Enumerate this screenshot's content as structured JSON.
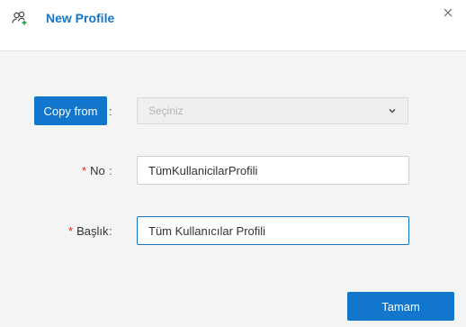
{
  "dialog": {
    "title": "New Profile",
    "header_icon": "add-users-icon",
    "close_icon": "close-icon"
  },
  "copy_from": {
    "button_label": "Copy from",
    "separator": ":",
    "select": {
      "value": "Seçiniz",
      "disabled": true,
      "icon": "chevron-down-icon"
    }
  },
  "no_field": {
    "required_mark": "*",
    "label": "No",
    "separator": ":",
    "value": "TümKullanicilarProfili"
  },
  "title_field": {
    "required_mark": "*",
    "label": "Başlık",
    "separator": ":",
    "value": "Tüm Kullanıcılar Profili",
    "focused": true
  },
  "footer": {
    "ok_label": "Tamam"
  },
  "colors": {
    "accent": "#1276cc",
    "title": "#1476c8",
    "required": "#e0241b",
    "background": "#f4f4f4"
  }
}
